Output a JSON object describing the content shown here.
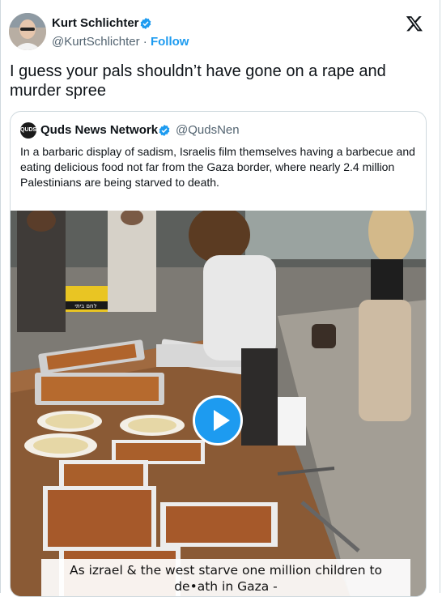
{
  "author": {
    "name": "Kurt Schlichter",
    "handle": "@KurtSchlichter",
    "separator": "·",
    "follow_label": "Follow"
  },
  "tweet": {
    "text": "I guess your pals shouldn’t have gone on a rape and murder spree"
  },
  "quoted": {
    "logo_text": "QUDS",
    "name": "Quds News Network",
    "handle": "@QudsNen",
    "text": "In a barbaric display of sadism, Israelis film themselves having a barbecue and eating delicious food not far from the Gaza border, where nearly 2.4 million Palestinians are being starved to death.",
    "video": {
      "sign_text": "לחם ביתי",
      "caption": "As izrael & the west starve one million children to de•ath in Gaza -"
    }
  },
  "icons": {
    "verified": "verified-badge-icon",
    "brand": "x-logo-icon",
    "play": "play-icon"
  },
  "colors": {
    "accent": "#1d9bf0",
    "text": "#0f1419",
    "muted": "#536471",
    "border": "#cfd9de"
  }
}
